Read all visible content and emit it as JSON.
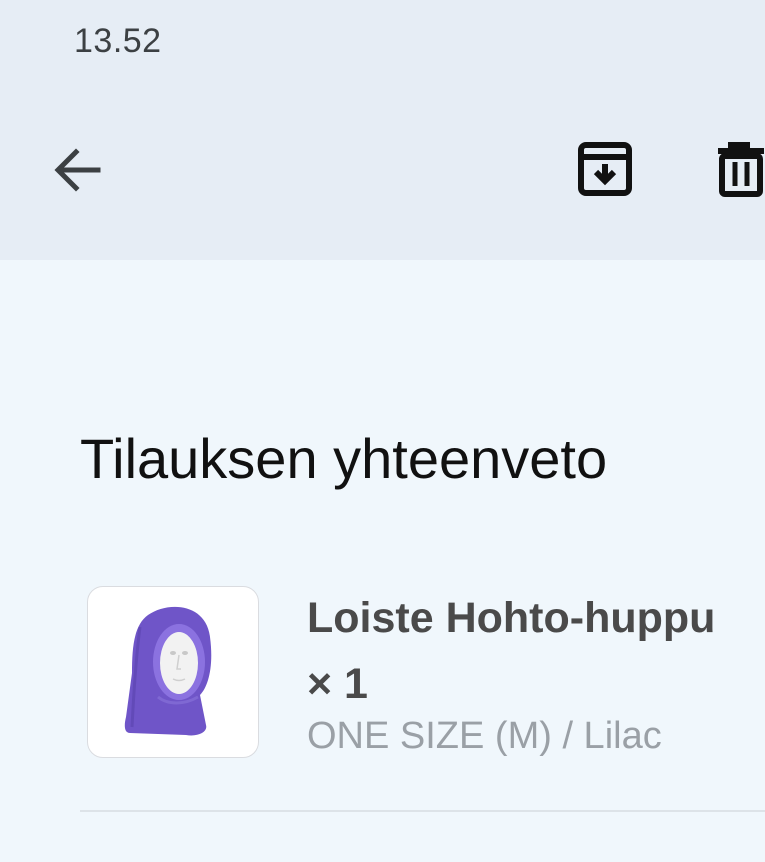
{
  "status_bar": {
    "time": "13.52"
  },
  "toolbar": {
    "icons": {
      "back": "arrow-left-icon",
      "archive": "archive-icon",
      "delete": "trash-icon"
    }
  },
  "summary": {
    "title": "Tilauksen yhteenveto",
    "item": {
      "name": "Loiste Hohto-huppu × 1",
      "variant": "ONE SIZE (M) / Lilac",
      "image": "balaclava-hood-product-image",
      "product_color": "#6f55c8"
    }
  },
  "colors": {
    "topbar_bg": "#e6edf5",
    "content_bg": "#f0f7fc",
    "title_text": "#111111",
    "item_text": "#4a4a4a",
    "muted_text": "#9aa0a6"
  }
}
